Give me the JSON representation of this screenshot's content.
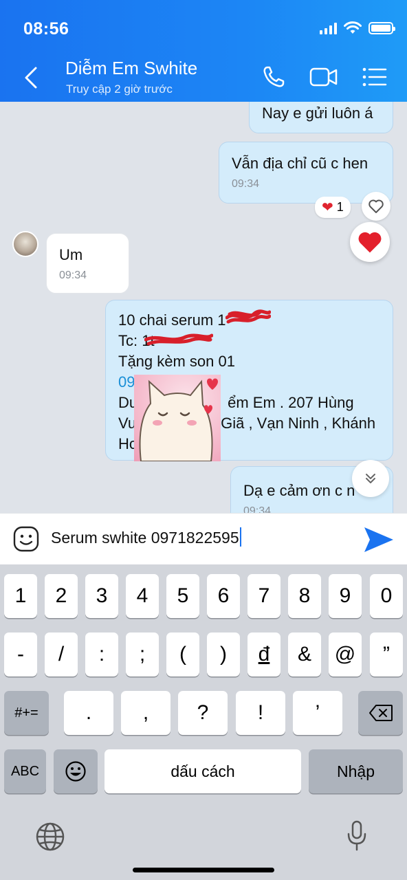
{
  "status_bar": {
    "time": "08:56"
  },
  "header": {
    "contact_name": "Diễm Em Swhite",
    "contact_status": "Truy cập 2 giờ trước",
    "icons": [
      "back-icon",
      "phone-icon",
      "video-call-icon",
      "menu-icon"
    ]
  },
  "messages": [
    {
      "id": "m1",
      "direction": "out",
      "lines": [
        "Nay e gửi luôn á"
      ]
    },
    {
      "id": "m2",
      "direction": "out",
      "lines": [
        "Vẫn địa chỉ cũ c hen"
      ],
      "time": "09:34",
      "reaction": {
        "emoji": "❤",
        "count": "1"
      }
    },
    {
      "id": "m3",
      "direction": "in",
      "lines": [
        "Um"
      ],
      "time": "09:34"
    },
    {
      "id": "m4",
      "direction": "out",
      "lines": [
        "10 chai serum 1",
        "Tc: 1t",
        "Tặng kèm son 01",
        "09",
        "Du",
        "Vu",
        "Ho"
      ],
      "line_tails": [
        "",
        "",
        "",
        "",
        "ểm Em . 207 Hùng",
        "Giã , Vạn Ninh , Khánh",
        ""
      ]
    },
    {
      "id": "m5",
      "direction": "out",
      "lines": [
        "Dạ e cảm ơn c n"
      ],
      "time": "09:34"
    }
  ],
  "composer": {
    "text": "Serum swhite 0971822595",
    "emoji_icon": "sticker-smile-icon",
    "send_icon": "send-icon"
  },
  "keyboard": {
    "row1": [
      "1",
      "2",
      "3",
      "4",
      "5",
      "6",
      "7",
      "8",
      "9",
      "0"
    ],
    "row2": [
      "-",
      "/",
      ":",
      ";",
      "(",
      ")",
      "đ",
      "&",
      "@",
      "”"
    ],
    "row3": [
      ".",
      ",",
      "?",
      "!",
      "’"
    ],
    "shift_label": "#+=",
    "abc_label": "ABC",
    "space_label": "dấu cách",
    "return_label": "Nhập",
    "icons": [
      "emoji-icon",
      "delete-icon",
      "globe-icon",
      "microphone-icon"
    ]
  },
  "colors": {
    "header_blue": "#1a80f3",
    "outgoing_bubble": "#d4ecfb",
    "send_blue": "#1a73f0"
  }
}
